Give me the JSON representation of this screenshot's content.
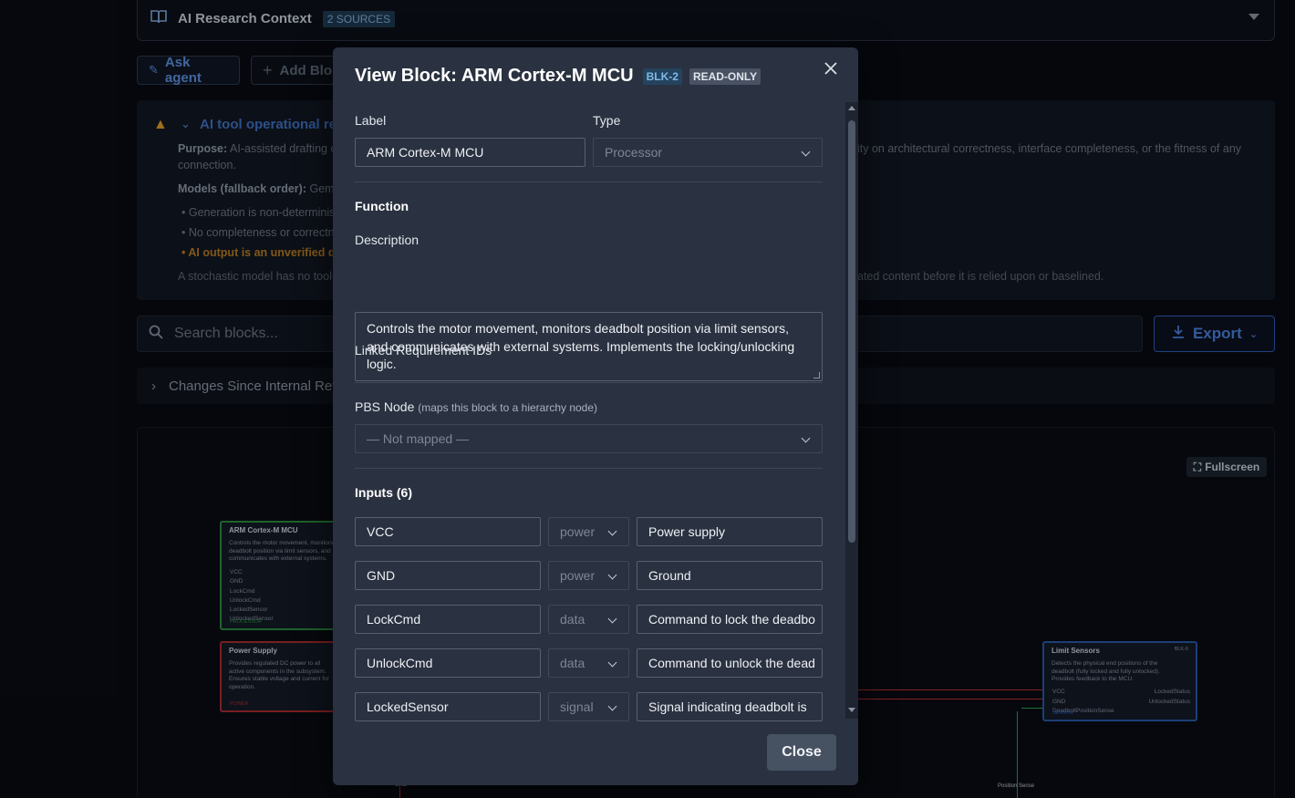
{
  "context": {
    "title": "AI Research Context",
    "sources_badge": "2 SOURCES"
  },
  "toolbar": {
    "ask_agent": "Ask agent",
    "add_block": "Add Blo"
  },
  "notice": {
    "title": "AI tool operational rec",
    "purpose_label": "Purpose:",
    "purpose_text": "AI-assisted drafting of",
    "purpose_right": "ity on architectural correctness, interface completeness, or the fitness of any",
    "purpose_cont": "connection.",
    "models_label": "Models (fallback order):",
    "models_text": "Gemin",
    "bullets": [
      "• Generation is non-determinist",
      "• No completeness or correctne",
      "• AI output is an unverified dr"
    ],
    "footer_left": "A stochastic model has no tool-c",
    "footer_right": "ated content before it is relied upon or baselined.",
    "accent_color": "#d89a2a"
  },
  "search": {
    "placeholder": "Search blocks..."
  },
  "export": {
    "label": "Export"
  },
  "changes": {
    "label": "Changes Since Internal Rev"
  },
  "canvas": {
    "fullscreen": "Fullscreen",
    "nodes": {
      "mcu": {
        "title": "ARM Cortex-M MCU",
        "desc": "Controls the motor movement, monitors deadbolt position via limit sensors, and communicates with external systems.",
        "ports": [
          "VCC",
          "GND",
          "LockCmd",
          "UnlockCmd",
          "LockedSensor",
          "UnlockedSensor"
        ],
        "tag": "PROCESSOR"
      },
      "psu": {
        "title": "Power Supply",
        "desc": "Provides regulated DC power to all active components in the subsystem. Ensures stable voltage and current for operation.",
        "tag": "POWER"
      },
      "ls": {
        "title": "Limit Sensors",
        "blk": "BLK-6",
        "desc": "Detects the physical end positions of the deadbolt (fully locked and fully unlocked). Provides feedback to the MCU.",
        "ports_left": [
          "VCC",
          "GND",
          "DeadboltPositionSense"
        ],
        "ports_right": [
          "LockedStatus",
          "UnlockedStatus"
        ],
        "tag": "SENSOR"
      }
    },
    "wire_labels": {
      "gnd": "GND",
      "position_sense": "Position Sense"
    }
  },
  "modal": {
    "title": "View Block: ARM Cortex-M MCU",
    "block_id": "BLK-2",
    "mode": "READ-ONLY",
    "label_field": {
      "label": "Label",
      "value": "ARM Cortex-M MCU"
    },
    "type_field": {
      "label": "Type",
      "value": "Processor"
    },
    "function_heading": "Function",
    "description": {
      "label": "Description",
      "value": "Controls the motor movement, monitors deadbolt position via limit sensors, and communicates with external systems. Implements the locking/unlocking logic."
    },
    "linked_req_label": "Linked Requirement IDs",
    "pbs": {
      "label": "PBS Node",
      "hint": "(maps this block to a hierarchy node)",
      "value": "— Not mapped —"
    },
    "inputs_heading": "Inputs (6)",
    "inputs": [
      {
        "name": "VCC",
        "kind": "power",
        "desc": "Power supply"
      },
      {
        "name": "GND",
        "kind": "power",
        "desc": "Ground"
      },
      {
        "name": "LockCmd",
        "kind": "data",
        "desc": "Command to lock the deadbo"
      },
      {
        "name": "UnlockCmd",
        "kind": "data",
        "desc": "Command to unlock the dead"
      },
      {
        "name": "LockedSensor",
        "kind": "signal",
        "desc": "Signal indicating deadbolt is"
      }
    ],
    "close_label": "Close"
  }
}
